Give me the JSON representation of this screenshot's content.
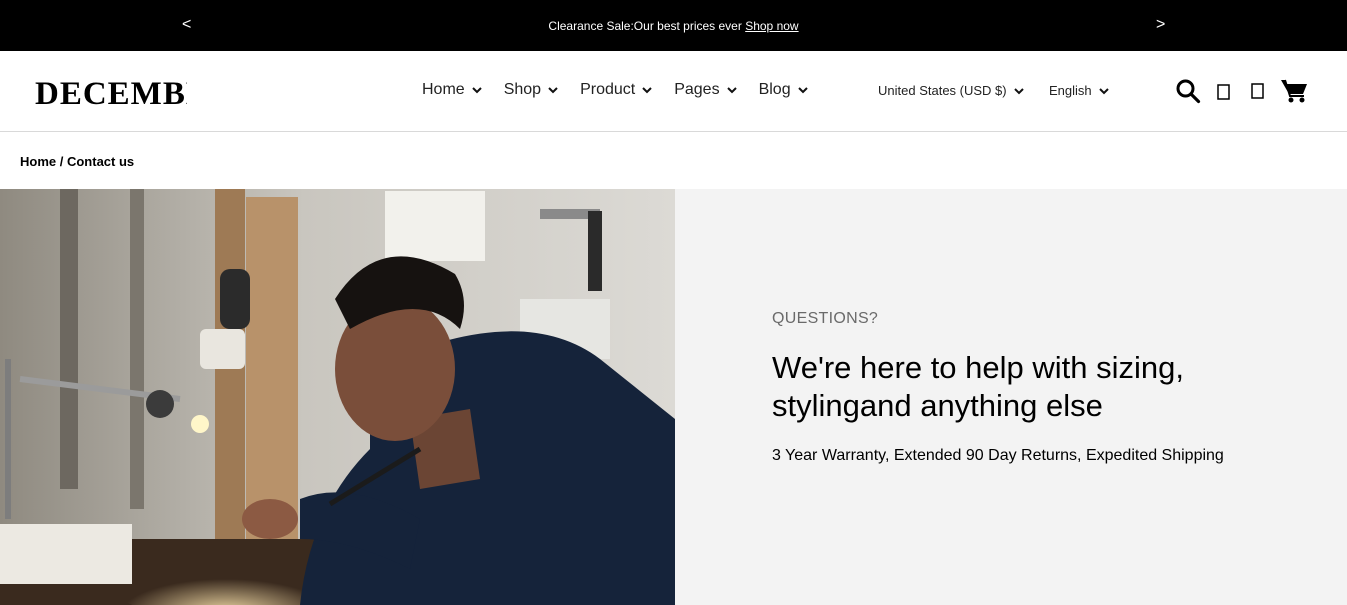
{
  "announcement": {
    "prev_label": "<",
    "next_label": ">",
    "message": "Clearance Sale:Our best prices ever",
    "link": "Shop now"
  },
  "header": {
    "logo_text": "DECEMBER",
    "nav": [
      {
        "label": "Home"
      },
      {
        "label": "Shop"
      },
      {
        "label": "Product"
      },
      {
        "label": "Pages"
      },
      {
        "label": "Blog"
      }
    ],
    "currency": "United States (USD $)",
    "language": "English",
    "icons": [
      "search-icon",
      "account-icon",
      "wishlist-icon",
      "cart-icon"
    ]
  },
  "breadcrumb": {
    "home": "Home",
    "separator": " / ",
    "current": "Contact us"
  },
  "hero": {
    "eyebrow": "QUESTIONS?",
    "headline": "We're here to help with sizing, stylingand anything else",
    "subline": "3 Year Warranty, Extended 90 Day Returns, Expedited Shipping"
  },
  "colors": {
    "announcement_bg": "#000000",
    "panel_bg": "#f3f3f3",
    "text": "#000000",
    "muted": "#6a6a6a"
  }
}
